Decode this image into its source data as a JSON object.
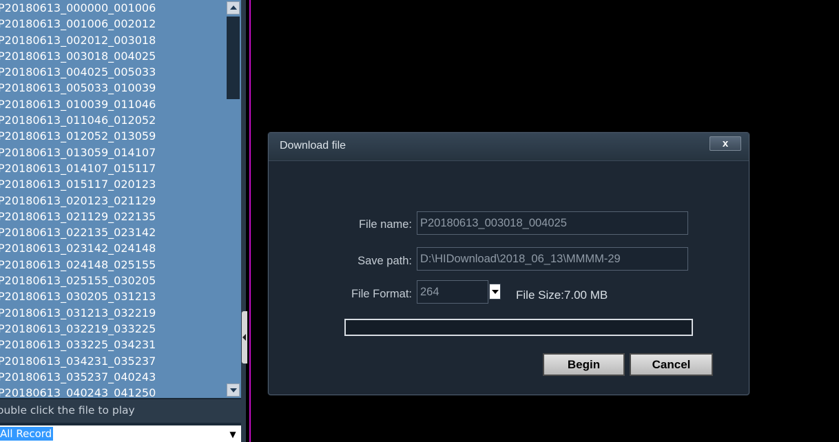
{
  "file_list": {
    "items": [
      "P20180613_000000_001006",
      "P20180613_001006_002012",
      "P20180613_002012_003018",
      "P20180613_003018_004025",
      "P20180613_004025_005033",
      "P20180613_005033_010039",
      "P20180613_010039_011046",
      "P20180613_011046_012052",
      "P20180613_012052_013059",
      "P20180613_013059_014107",
      "P20180613_014107_015117",
      "P20180613_015117_020123",
      "P20180613_020123_021129",
      "P20180613_021129_022135",
      "P20180613_022135_023142",
      "P20180613_023142_024148",
      "P20180613_024148_025155",
      "P20180613_025155_030205",
      "P20180613_030205_031213",
      "P20180613_031213_032219",
      "P20180613_032219_033225",
      "P20180613_033225_034231",
      "P20180613_034231_035237",
      "P20180613_035237_040243",
      "P20180613_040243_041250"
    ],
    "hint": "ouble click the file to play",
    "record_filter": {
      "selected": "All Record",
      "arrow_icon": "▼"
    }
  },
  "dialog": {
    "title": "Download file",
    "close_label": "x",
    "file_name_label": "File name:",
    "file_name_value": "P20180613_003018_004025",
    "save_path_label": "Save path:",
    "save_path_value": "D:\\HIDownload\\2018_06_13\\MMMM-29",
    "file_format_label": "File Format:",
    "file_format_value": "264",
    "file_size": "File Size:7.00 MB",
    "progress_fraction": 0,
    "begin_label": "Begin",
    "cancel_label": "Cancel"
  },
  "colors": {
    "list_background": "#5e8bb6",
    "dialog_background": "#1d2733",
    "accent_separator": "#c40ec4"
  }
}
